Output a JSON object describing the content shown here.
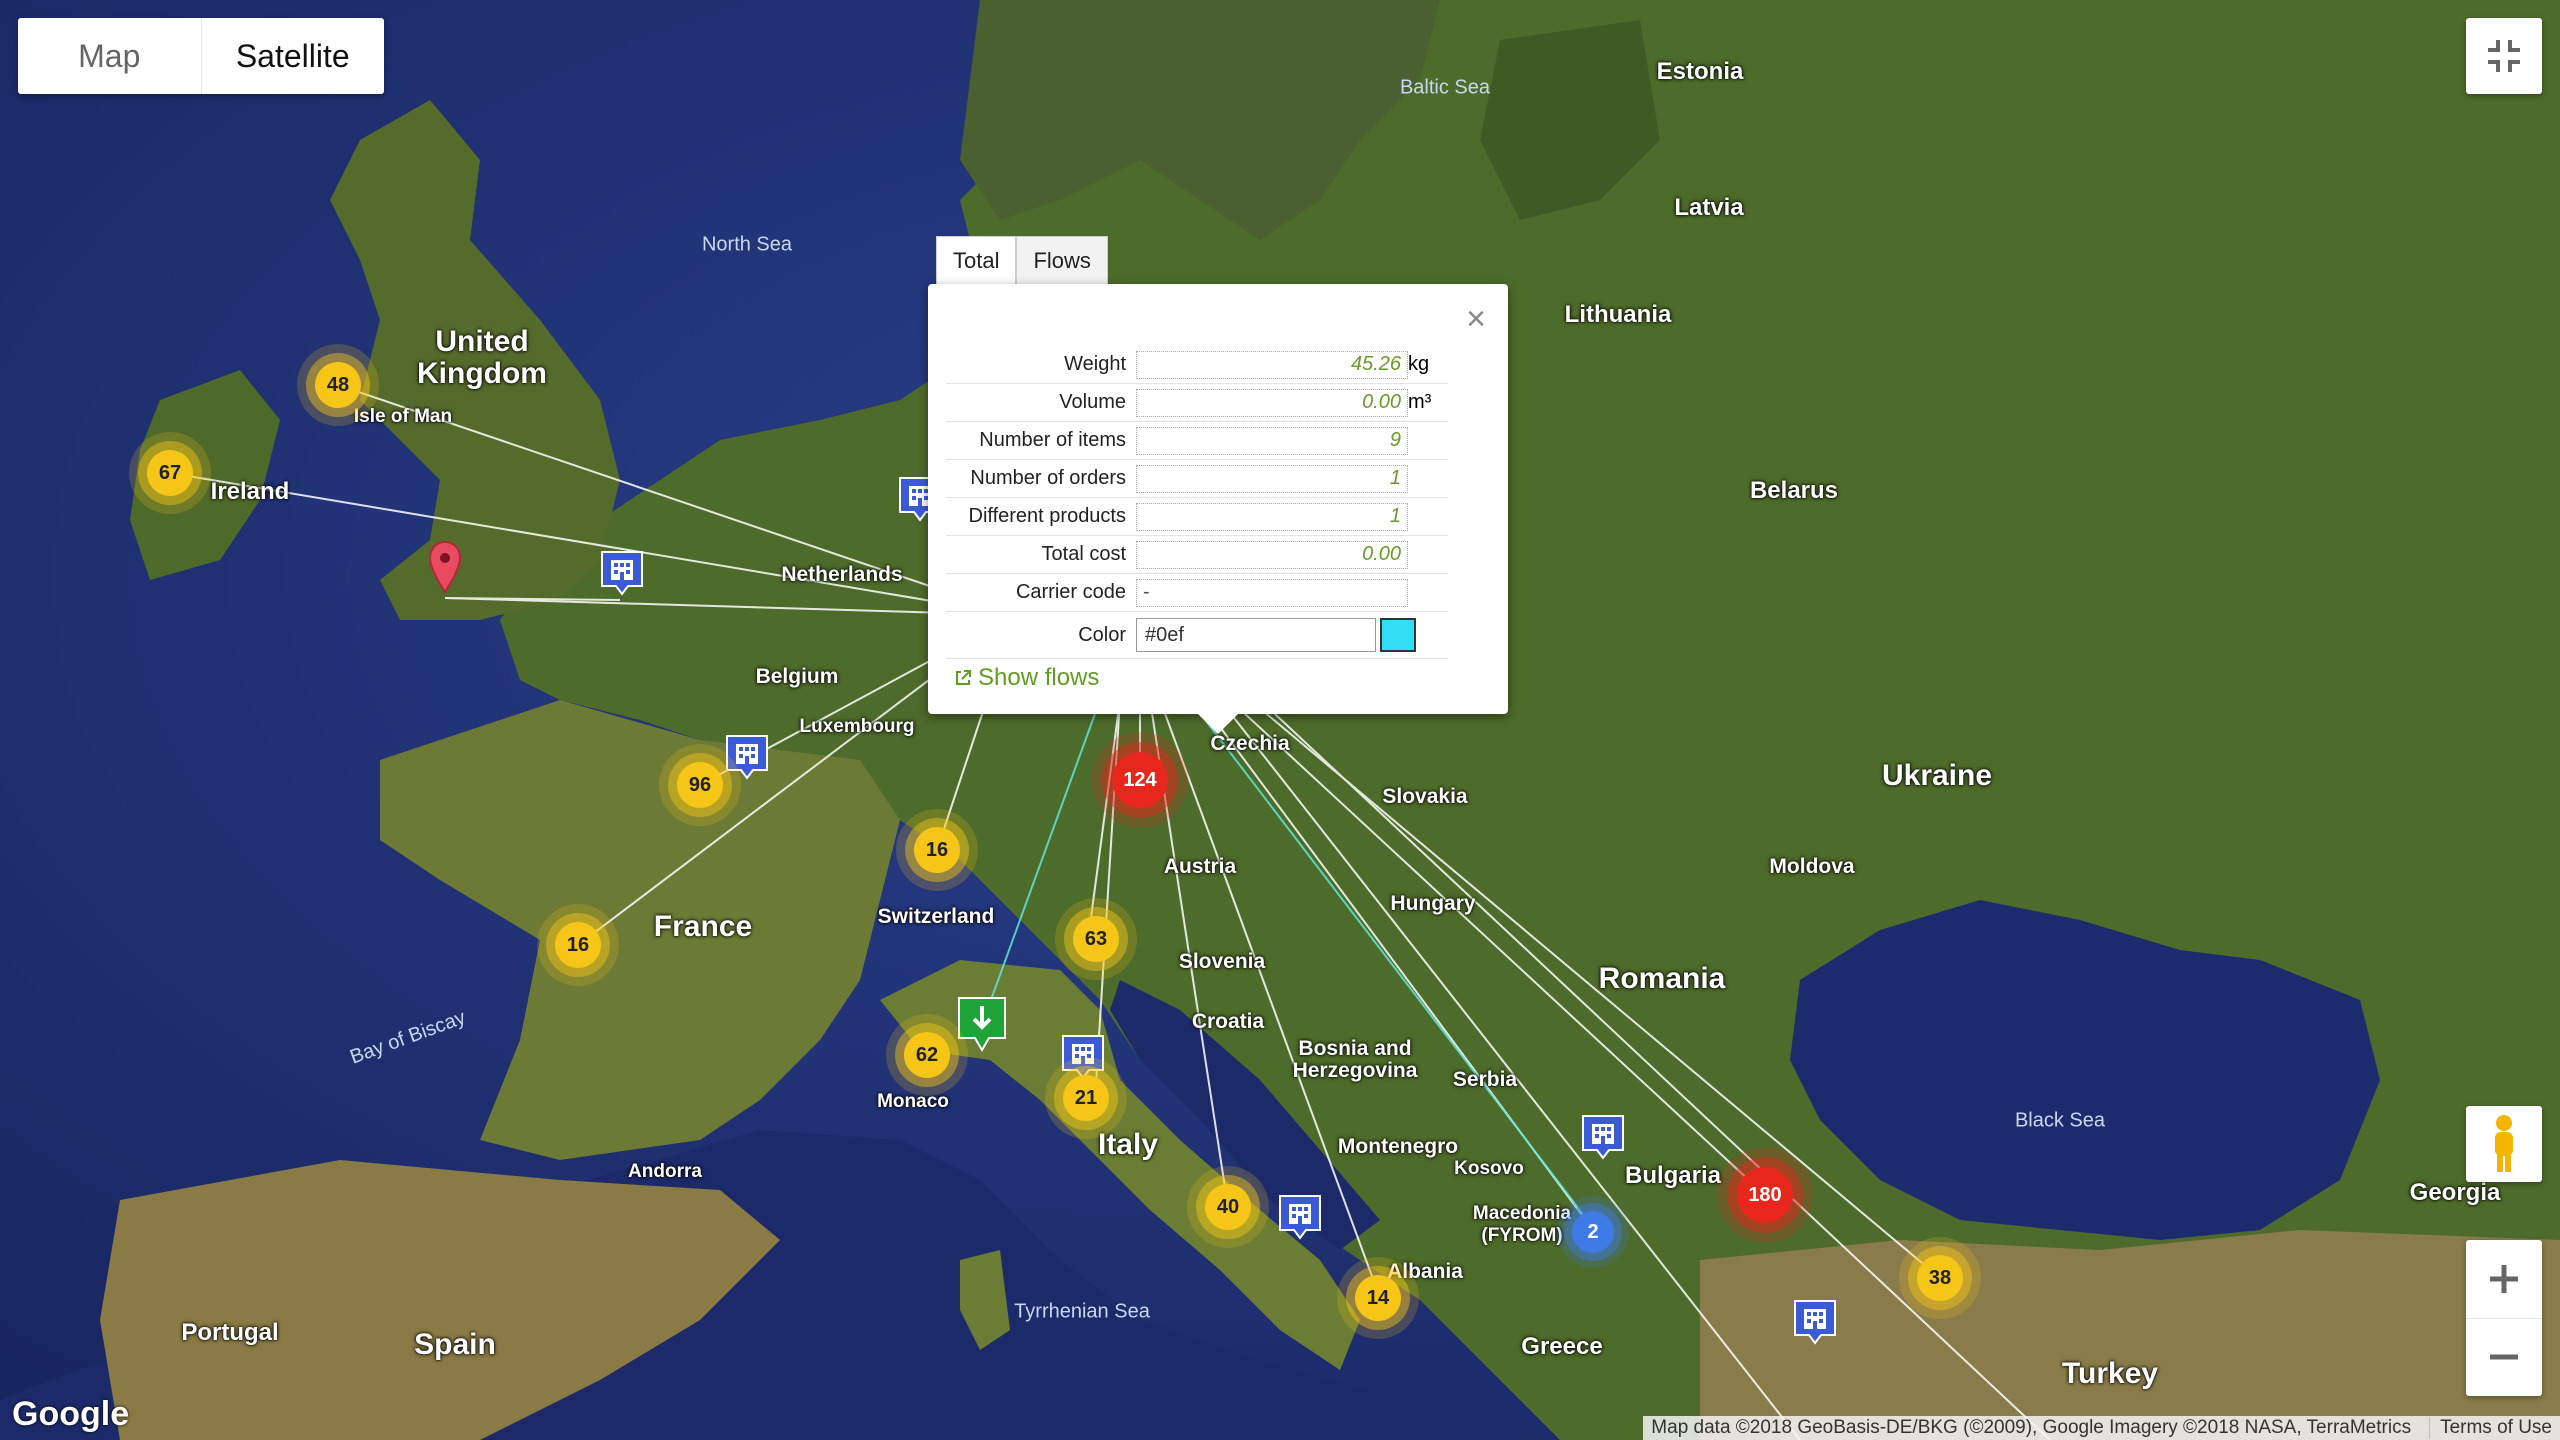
{
  "map_type": {
    "map_label": "Map",
    "satellite_label": "Satellite",
    "selected": "Satellite"
  },
  "countries": {
    "uk": "United\nKingdom",
    "ireland": "Ireland",
    "france": "France",
    "spain": "Spain",
    "portugal": "Portugal",
    "italy": "Italy",
    "netherlands": "Netherlands",
    "belgium": "Belgium",
    "luxembourg": "Luxembourg",
    "switzerland": "Switzerland",
    "austria": "Austria",
    "czechia": "Czechia",
    "slovakia": "Slovakia",
    "hungary": "Hungary",
    "slovenia": "Slovenia",
    "croatia": "Croatia",
    "bosnia": "Bosnia and\nHerzegovina",
    "serbia": "Serbia",
    "montenegro": "Montenegro",
    "kosovo": "Kosovo",
    "macedonia": "Macedonia\n(FYROM)",
    "albania": "Albania",
    "greece": "Greece",
    "bulgaria": "Bulgaria",
    "romania": "Romania",
    "moldova": "Moldova",
    "ukraine": "Ukraine",
    "belarus": "Belarus",
    "lithuania": "Lithuania",
    "latvia": "Latvia",
    "estonia": "Estonia",
    "turkey": "Turkey",
    "georgia": "Georgia",
    "monaco": "Monaco",
    "andorra": "Andorra",
    "isle_of_man": "Isle of Man"
  },
  "seas": {
    "north": "North Sea",
    "baltic": "Baltic Sea",
    "black": "Black Sea",
    "biscay": "Bay of Biscay",
    "tyrrhenian": "Tyrrhenian Sea"
  },
  "clusters": [
    {
      "id": "c48",
      "count": "48",
      "color": "yellow"
    },
    {
      "id": "c67",
      "count": "67",
      "color": "yellow"
    },
    {
      "id": "c96",
      "count": "96",
      "color": "yellow"
    },
    {
      "id": "c16a",
      "count": "16",
      "color": "yellow"
    },
    {
      "id": "c16b",
      "count": "16",
      "color": "yellow"
    },
    {
      "id": "c124",
      "count": "124",
      "color": "red"
    },
    {
      "id": "c63",
      "count": "63",
      "color": "yellow"
    },
    {
      "id": "c62",
      "count": "62",
      "color": "yellow"
    },
    {
      "id": "c21",
      "count": "21",
      "color": "yellow"
    },
    {
      "id": "c40",
      "count": "40",
      "color": "yellow"
    },
    {
      "id": "c14",
      "count": "14",
      "color": "yellow"
    },
    {
      "id": "c180",
      "count": "180",
      "color": "red"
    },
    {
      "id": "c38",
      "count": "38",
      "color": "yellow"
    },
    {
      "id": "c2",
      "count": "2",
      "color": "blue"
    }
  ],
  "popup": {
    "tabs": [
      "Total",
      "Flows"
    ],
    "active_tab": "Total",
    "close_glyph": "×",
    "rows": [
      {
        "label": "Weight",
        "value": "45.26",
        "unit": "kg"
      },
      {
        "label": "Volume",
        "value": "0.00",
        "unit": "m³"
      },
      {
        "label": "Number of items",
        "value": "9",
        "unit": ""
      },
      {
        "label": "Number of orders",
        "value": "1",
        "unit": ""
      },
      {
        "label": "Different products",
        "value": "1",
        "unit": ""
      },
      {
        "label": "Total cost",
        "value": "0.00",
        "unit": ""
      },
      {
        "label": "Carrier code",
        "value": "-",
        "unit": ""
      }
    ],
    "color_label": "Color",
    "color_value": "#0ef",
    "swatch_color": "#33ddf5",
    "show_flows": "Show flows"
  },
  "attribution": "Map data ©2018 GeoBasis-DE/BKG (©2009), Google Imagery ©2018 NASA, TerraMetrics",
  "terms": "Terms of Use",
  "logo": "Google",
  "colors": {
    "flow_line": "#ffffff",
    "flow_cyan": "#5ee6d8",
    "marker_building": "#3b5bd6",
    "marker_pin": "#e84a5f",
    "marker_green": "#1fa43a"
  }
}
